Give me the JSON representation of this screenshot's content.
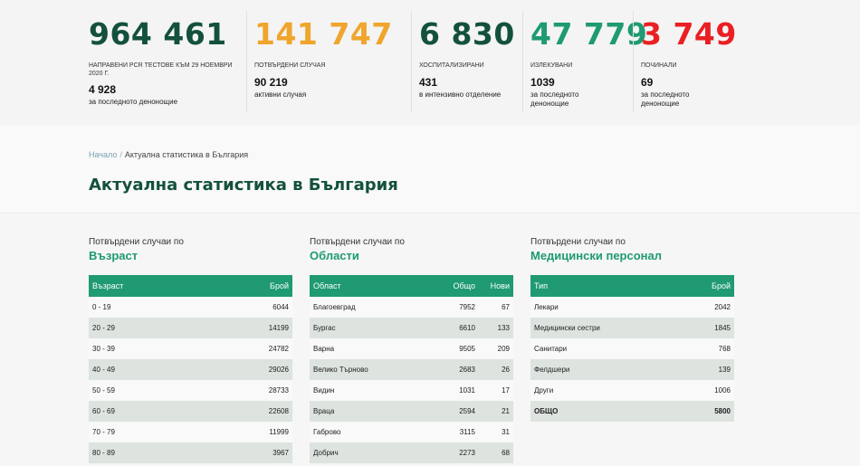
{
  "stats": [
    {
      "value": "964 461",
      "label_lines": [
        "НАПРАВЕНИ PCR ТЕСТОВЕ КЪМ 29 НОЕМВРИ",
        "2020 Г."
      ],
      "sub_value": "4 928",
      "sub_label_lines": [
        "за последното денонощие"
      ],
      "color": "#14503e"
    },
    {
      "value": "141 747",
      "label_lines": [
        "ПОТВЪРДЕНИ СЛУЧАЯ"
      ],
      "sub_value": "90 219",
      "sub_label_lines": [
        "активни случая"
      ],
      "color": "#f0a52c"
    },
    {
      "value": "6 830",
      "label_lines": [
        "ХОСПИТАЛИЗИРАНИ"
      ],
      "sub_value": "431",
      "sub_label_lines": [
        "в интензивно отделение"
      ],
      "color": "#14503e"
    },
    {
      "value": "47 779",
      "label_lines": [
        "ИЗЛЕКУВАНИ"
      ],
      "sub_value": "1039",
      "sub_label_lines": [
        "за последното",
        "денонощие"
      ],
      "color": "#1f9a72"
    },
    {
      "value": "3 749",
      "label_lines": [
        "ПОЧИНАЛИ"
      ],
      "sub_value": "69",
      "sub_label_lines": [
        "за последното",
        "денонощие"
      ],
      "color": "#ea1f23"
    }
  ],
  "breadcrumb": {
    "home": "Начало",
    "separator": "/",
    "current": "Актуална статистика в България"
  },
  "page_title": "Актуална статистика в България",
  "age_table": {
    "caption_top": "Потвърдени случаи по",
    "caption": "Възраст",
    "headers": [
      "Възраст",
      "Брой"
    ],
    "rows": [
      [
        "0 - 19",
        "6044"
      ],
      [
        "20 - 29",
        "14199"
      ],
      [
        "30 - 39",
        "24782"
      ],
      [
        "40 - 49",
        "29026"
      ],
      [
        "50 - 59",
        "28733"
      ],
      [
        "60 - 69",
        "22608"
      ],
      [
        "70 - 79",
        "11999"
      ],
      [
        "80 - 89",
        "3967"
      ]
    ]
  },
  "region_table": {
    "caption_top": "Потвърдени случаи по",
    "caption": "Области",
    "headers": [
      "Област",
      "Общо",
      "Нови"
    ],
    "rows": [
      [
        "Благоевград",
        "7952",
        "67"
      ],
      [
        "Бургас",
        "6610",
        "133"
      ],
      [
        "Варна",
        "9505",
        "209"
      ],
      [
        "Велико Търново",
        "2683",
        "26"
      ],
      [
        "Видин",
        "1031",
        "17"
      ],
      [
        "Враца",
        "2594",
        "21"
      ],
      [
        "Габрово",
        "3115",
        "31"
      ],
      [
        "Добрич",
        "2273",
        "68"
      ]
    ]
  },
  "medical_table": {
    "caption_top": "Потвърдени случаи по",
    "caption": "Медицински персонал",
    "headers": [
      "Тип",
      "Брой"
    ],
    "rows": [
      [
        "Лекари",
        "2042"
      ],
      [
        "Медицински сестри",
        "1845"
      ],
      [
        "Санитари",
        "768"
      ],
      [
        "Фелдшери",
        "139"
      ],
      [
        "Други",
        "1006"
      ],
      [
        "ОБЩО",
        "5800"
      ]
    ]
  }
}
